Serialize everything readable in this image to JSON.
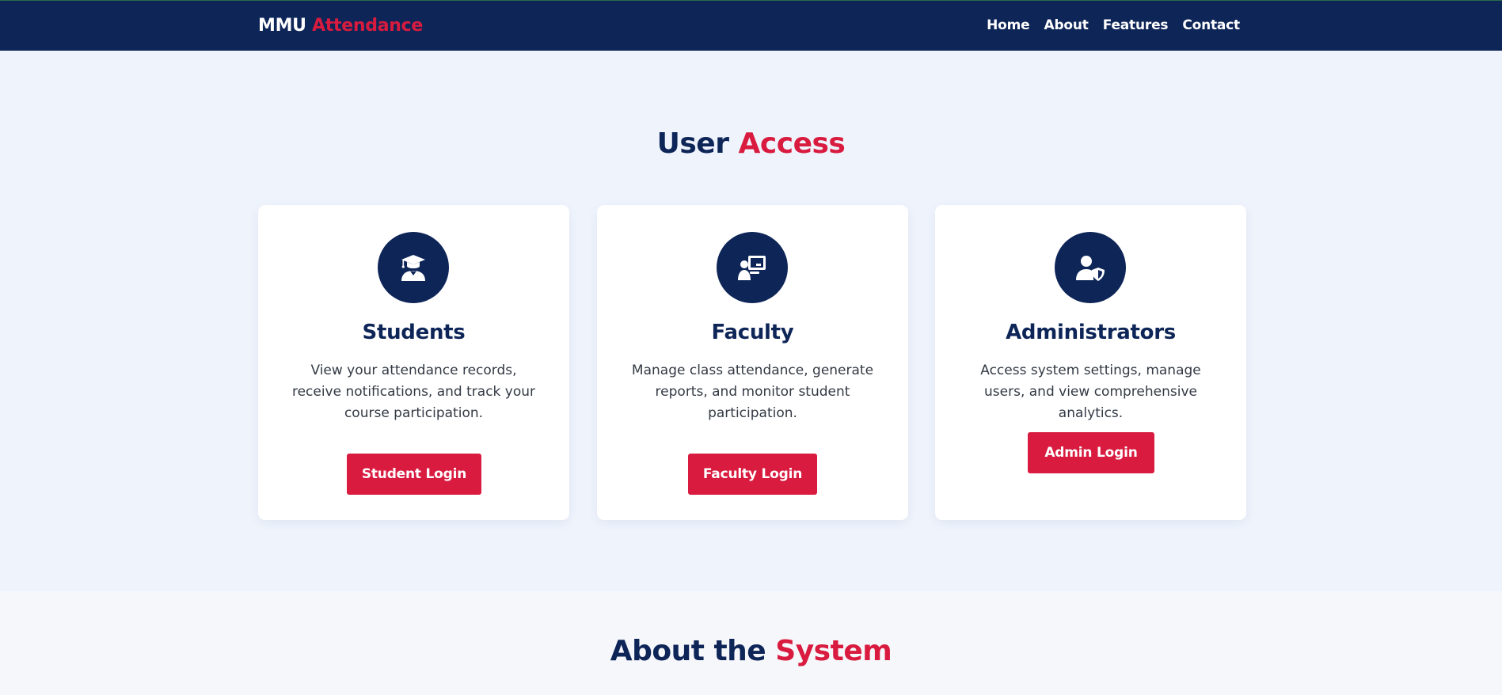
{
  "nav": {
    "brand_primary": "MMU",
    "brand_accent": "Attendance",
    "links": [
      "Home",
      "About",
      "Features",
      "Contact"
    ]
  },
  "access": {
    "title_dark": "User",
    "title_accent": "Access",
    "cards": [
      {
        "icon": "graduate-icon",
        "title": "Students",
        "description": "View your attendance records, receive notifications, and track your course participation.",
        "button": "Student Login"
      },
      {
        "icon": "teacher-board-icon",
        "title": "Faculty",
        "description": "Manage class attendance, generate reports, and monitor student participation.",
        "button": "Faculty Login"
      },
      {
        "icon": "user-shield-icon",
        "title": "Administrators",
        "description": "Access system settings, manage users, and view comprehensive analytics.",
        "button": "Admin Login"
      }
    ]
  },
  "about": {
    "title_dark": "About the",
    "title_accent": "System"
  },
  "colors": {
    "navy": "#0e2558",
    "accent_red": "#d81b3f",
    "section_bg": "#eef3fc",
    "about_bg": "#f6f7fa"
  }
}
